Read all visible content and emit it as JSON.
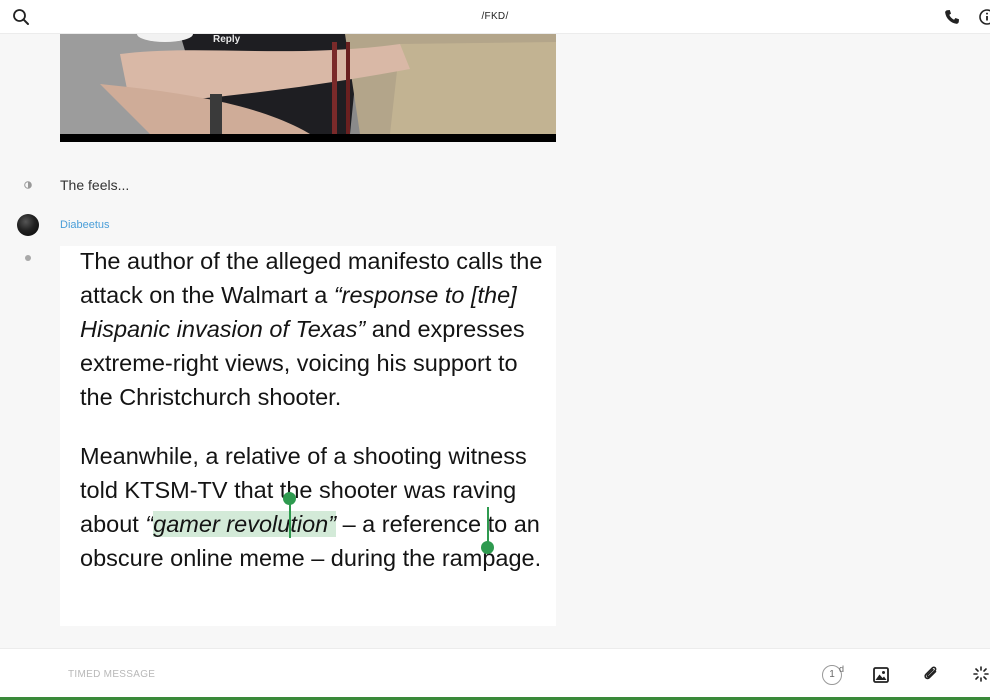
{
  "header": {
    "title": "/FKD/",
    "icons": {
      "search": "search-icon",
      "call": "phone-icon",
      "info": "info-icon"
    }
  },
  "messages": [
    {
      "type": "image",
      "overlay_text": "Reply"
    },
    {
      "type": "text",
      "text": "The feels..."
    },
    {
      "type": "image_text",
      "sender": "Diabeetus",
      "paragraph1": {
        "a": "The author of the alleged manifesto calls the attack on the Walmart a ",
        "b": "“response to [the] Hispanic invasion of Texas”",
        "c": " and expresses extreme-right views, voicing his support to the Christchurch shooter."
      },
      "paragraph2": {
        "a": "Meanwhile, a relative of a shooting witness told KTSM-TV that the shooter was raving about ",
        "quote_open": "“",
        "selected": "gamer revolution",
        "quote_close": "”",
        "c": " – a reference to an obscure online meme – during the rampage."
      }
    }
  ],
  "composer": {
    "placeholder": "TIMED MESSAGE",
    "timer_value": "1",
    "timer_unit": "d",
    "icons": {
      "image": "image-icon",
      "attach": "paperclip-icon",
      "more": "sparkle-icon"
    }
  },
  "colors": {
    "accent_green": "#2e9a4f",
    "sender_blue": "#4a9ed8",
    "selection": "#d3ead8"
  }
}
